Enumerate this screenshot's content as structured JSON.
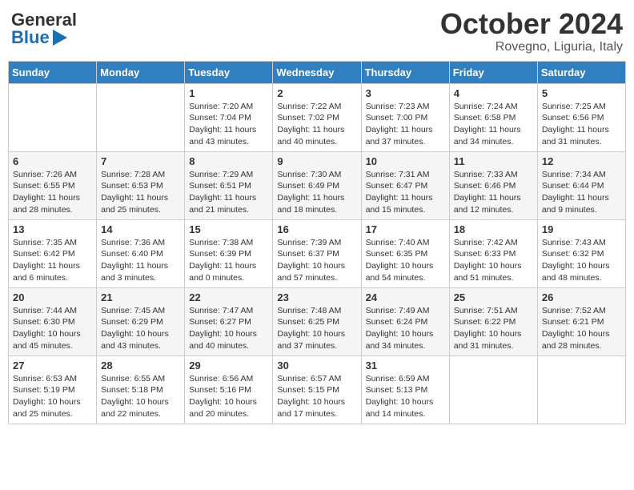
{
  "header": {
    "logo_general": "General",
    "logo_blue": "Blue",
    "month": "October 2024",
    "location": "Rovegno, Liguria, Italy"
  },
  "days_of_week": [
    "Sunday",
    "Monday",
    "Tuesday",
    "Wednesday",
    "Thursday",
    "Friday",
    "Saturday"
  ],
  "weeks": [
    [
      {
        "day": "",
        "info": ""
      },
      {
        "day": "",
        "info": ""
      },
      {
        "day": "1",
        "info": "Sunrise: 7:20 AM\nSunset: 7:04 PM\nDaylight: 11 hours and 43 minutes."
      },
      {
        "day": "2",
        "info": "Sunrise: 7:22 AM\nSunset: 7:02 PM\nDaylight: 11 hours and 40 minutes."
      },
      {
        "day": "3",
        "info": "Sunrise: 7:23 AM\nSunset: 7:00 PM\nDaylight: 11 hours and 37 minutes."
      },
      {
        "day": "4",
        "info": "Sunrise: 7:24 AM\nSunset: 6:58 PM\nDaylight: 11 hours and 34 minutes."
      },
      {
        "day": "5",
        "info": "Sunrise: 7:25 AM\nSunset: 6:56 PM\nDaylight: 11 hours and 31 minutes."
      }
    ],
    [
      {
        "day": "6",
        "info": "Sunrise: 7:26 AM\nSunset: 6:55 PM\nDaylight: 11 hours and 28 minutes."
      },
      {
        "day": "7",
        "info": "Sunrise: 7:28 AM\nSunset: 6:53 PM\nDaylight: 11 hours and 25 minutes."
      },
      {
        "day": "8",
        "info": "Sunrise: 7:29 AM\nSunset: 6:51 PM\nDaylight: 11 hours and 21 minutes."
      },
      {
        "day": "9",
        "info": "Sunrise: 7:30 AM\nSunset: 6:49 PM\nDaylight: 11 hours and 18 minutes."
      },
      {
        "day": "10",
        "info": "Sunrise: 7:31 AM\nSunset: 6:47 PM\nDaylight: 11 hours and 15 minutes."
      },
      {
        "day": "11",
        "info": "Sunrise: 7:33 AM\nSunset: 6:46 PM\nDaylight: 11 hours and 12 minutes."
      },
      {
        "day": "12",
        "info": "Sunrise: 7:34 AM\nSunset: 6:44 PM\nDaylight: 11 hours and 9 minutes."
      }
    ],
    [
      {
        "day": "13",
        "info": "Sunrise: 7:35 AM\nSunset: 6:42 PM\nDaylight: 11 hours and 6 minutes."
      },
      {
        "day": "14",
        "info": "Sunrise: 7:36 AM\nSunset: 6:40 PM\nDaylight: 11 hours and 3 minutes."
      },
      {
        "day": "15",
        "info": "Sunrise: 7:38 AM\nSunset: 6:39 PM\nDaylight: 11 hours and 0 minutes."
      },
      {
        "day": "16",
        "info": "Sunrise: 7:39 AM\nSunset: 6:37 PM\nDaylight: 10 hours and 57 minutes."
      },
      {
        "day": "17",
        "info": "Sunrise: 7:40 AM\nSunset: 6:35 PM\nDaylight: 10 hours and 54 minutes."
      },
      {
        "day": "18",
        "info": "Sunrise: 7:42 AM\nSunset: 6:33 PM\nDaylight: 10 hours and 51 minutes."
      },
      {
        "day": "19",
        "info": "Sunrise: 7:43 AM\nSunset: 6:32 PM\nDaylight: 10 hours and 48 minutes."
      }
    ],
    [
      {
        "day": "20",
        "info": "Sunrise: 7:44 AM\nSunset: 6:30 PM\nDaylight: 10 hours and 45 minutes."
      },
      {
        "day": "21",
        "info": "Sunrise: 7:45 AM\nSunset: 6:29 PM\nDaylight: 10 hours and 43 minutes."
      },
      {
        "day": "22",
        "info": "Sunrise: 7:47 AM\nSunset: 6:27 PM\nDaylight: 10 hours and 40 minutes."
      },
      {
        "day": "23",
        "info": "Sunrise: 7:48 AM\nSunset: 6:25 PM\nDaylight: 10 hours and 37 minutes."
      },
      {
        "day": "24",
        "info": "Sunrise: 7:49 AM\nSunset: 6:24 PM\nDaylight: 10 hours and 34 minutes."
      },
      {
        "day": "25",
        "info": "Sunrise: 7:51 AM\nSunset: 6:22 PM\nDaylight: 10 hours and 31 minutes."
      },
      {
        "day": "26",
        "info": "Sunrise: 7:52 AM\nSunset: 6:21 PM\nDaylight: 10 hours and 28 minutes."
      }
    ],
    [
      {
        "day": "27",
        "info": "Sunrise: 6:53 AM\nSunset: 5:19 PM\nDaylight: 10 hours and 25 minutes."
      },
      {
        "day": "28",
        "info": "Sunrise: 6:55 AM\nSunset: 5:18 PM\nDaylight: 10 hours and 22 minutes."
      },
      {
        "day": "29",
        "info": "Sunrise: 6:56 AM\nSunset: 5:16 PM\nDaylight: 10 hours and 20 minutes."
      },
      {
        "day": "30",
        "info": "Sunrise: 6:57 AM\nSunset: 5:15 PM\nDaylight: 10 hours and 17 minutes."
      },
      {
        "day": "31",
        "info": "Sunrise: 6:59 AM\nSunset: 5:13 PM\nDaylight: 10 hours and 14 minutes."
      },
      {
        "day": "",
        "info": ""
      },
      {
        "day": "",
        "info": ""
      }
    ]
  ]
}
